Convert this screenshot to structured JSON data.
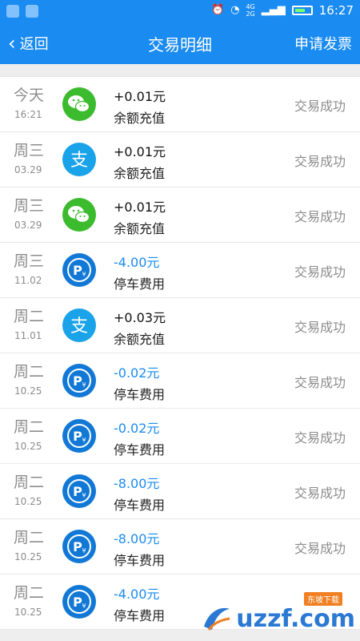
{
  "status_bar": {
    "time": "16:27",
    "net_4g": "4G",
    "net_2g": "2G"
  },
  "nav": {
    "back_label": "返回",
    "title": "交易明细",
    "action_label": "申请发票"
  },
  "transactions": [
    {
      "day": "今天",
      "time": "16:21",
      "icon": "wechat-icon",
      "amount": "+0.01元",
      "category": "余额充值",
      "status": "交易成功"
    },
    {
      "day": "周三",
      "time": "03.29",
      "icon": "alipay-icon",
      "amount": "+0.01元",
      "category": "余额充值",
      "status": "交易成功"
    },
    {
      "day": "周三",
      "time": "03.29",
      "icon": "wechat-icon",
      "amount": "+0.01元",
      "category": "余额充值",
      "status": "交易成功"
    },
    {
      "day": "周三",
      "time": "11.02",
      "icon": "parking-icon",
      "amount": "-4.00元",
      "category": "停车费用",
      "status": "交易成功"
    },
    {
      "day": "周二",
      "time": "11.01",
      "icon": "alipay-icon",
      "amount": "+0.03元",
      "category": "余额充值",
      "status": "交易成功"
    },
    {
      "day": "周二",
      "time": "10.25",
      "icon": "parking-icon",
      "amount": "-0.02元",
      "category": "停车费用",
      "status": "交易成功"
    },
    {
      "day": "周二",
      "time": "10.25",
      "icon": "parking-icon",
      "amount": "-0.02元",
      "category": "停车费用",
      "status": "交易成功"
    },
    {
      "day": "周二",
      "time": "10.25",
      "icon": "parking-icon",
      "amount": "-8.00元",
      "category": "停车费用",
      "status": "交易成功"
    },
    {
      "day": "周二",
      "time": "10.25",
      "icon": "parking-icon",
      "amount": "-8.00元",
      "category": "停车费用",
      "status": "交易成功"
    },
    {
      "day": "周二",
      "time": "10.25",
      "icon": "parking-icon",
      "amount": "-4.00元",
      "category": "停车费用",
      "status": ""
    }
  ],
  "watermark": {
    "text": "uzzf.com",
    "badge": "东坡下载"
  },
  "colors": {
    "primary": "#1a8bf0",
    "wechat": "#3cbb2e",
    "alipay": "#1aa3e8",
    "parking": "#1278d6",
    "muted": "#8c8c8c"
  }
}
